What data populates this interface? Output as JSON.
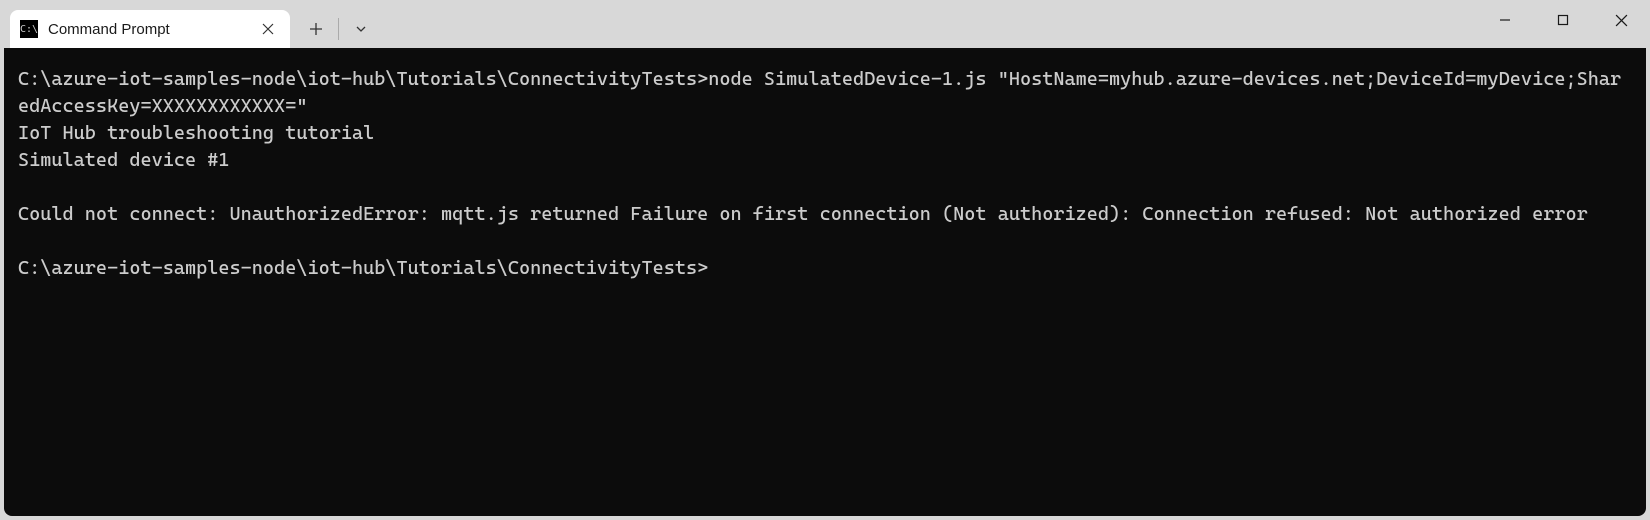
{
  "tab": {
    "title": "Command Prompt",
    "icon_glyph": "C:\\"
  },
  "terminal": {
    "lines": [
      "C:\\azure-iot-samples-node\\iot-hub\\Tutorials\\ConnectivityTests>node SimulatedDevice-1.js \"HostName=myhub.azure-devices.net;DeviceId=myDevice;SharedAccessKey=XXXXXXXXXXXX=\"",
      "IoT Hub troubleshooting tutorial",
      "Simulated device #1",
      "",
      "Could not connect: UnauthorizedError: mqtt.js returned Failure on first connection (Not authorized): Connection refused: Not authorized error",
      "",
      "C:\\azure-iot-samples-node\\iot-hub\\Tutorials\\ConnectivityTests>"
    ]
  }
}
